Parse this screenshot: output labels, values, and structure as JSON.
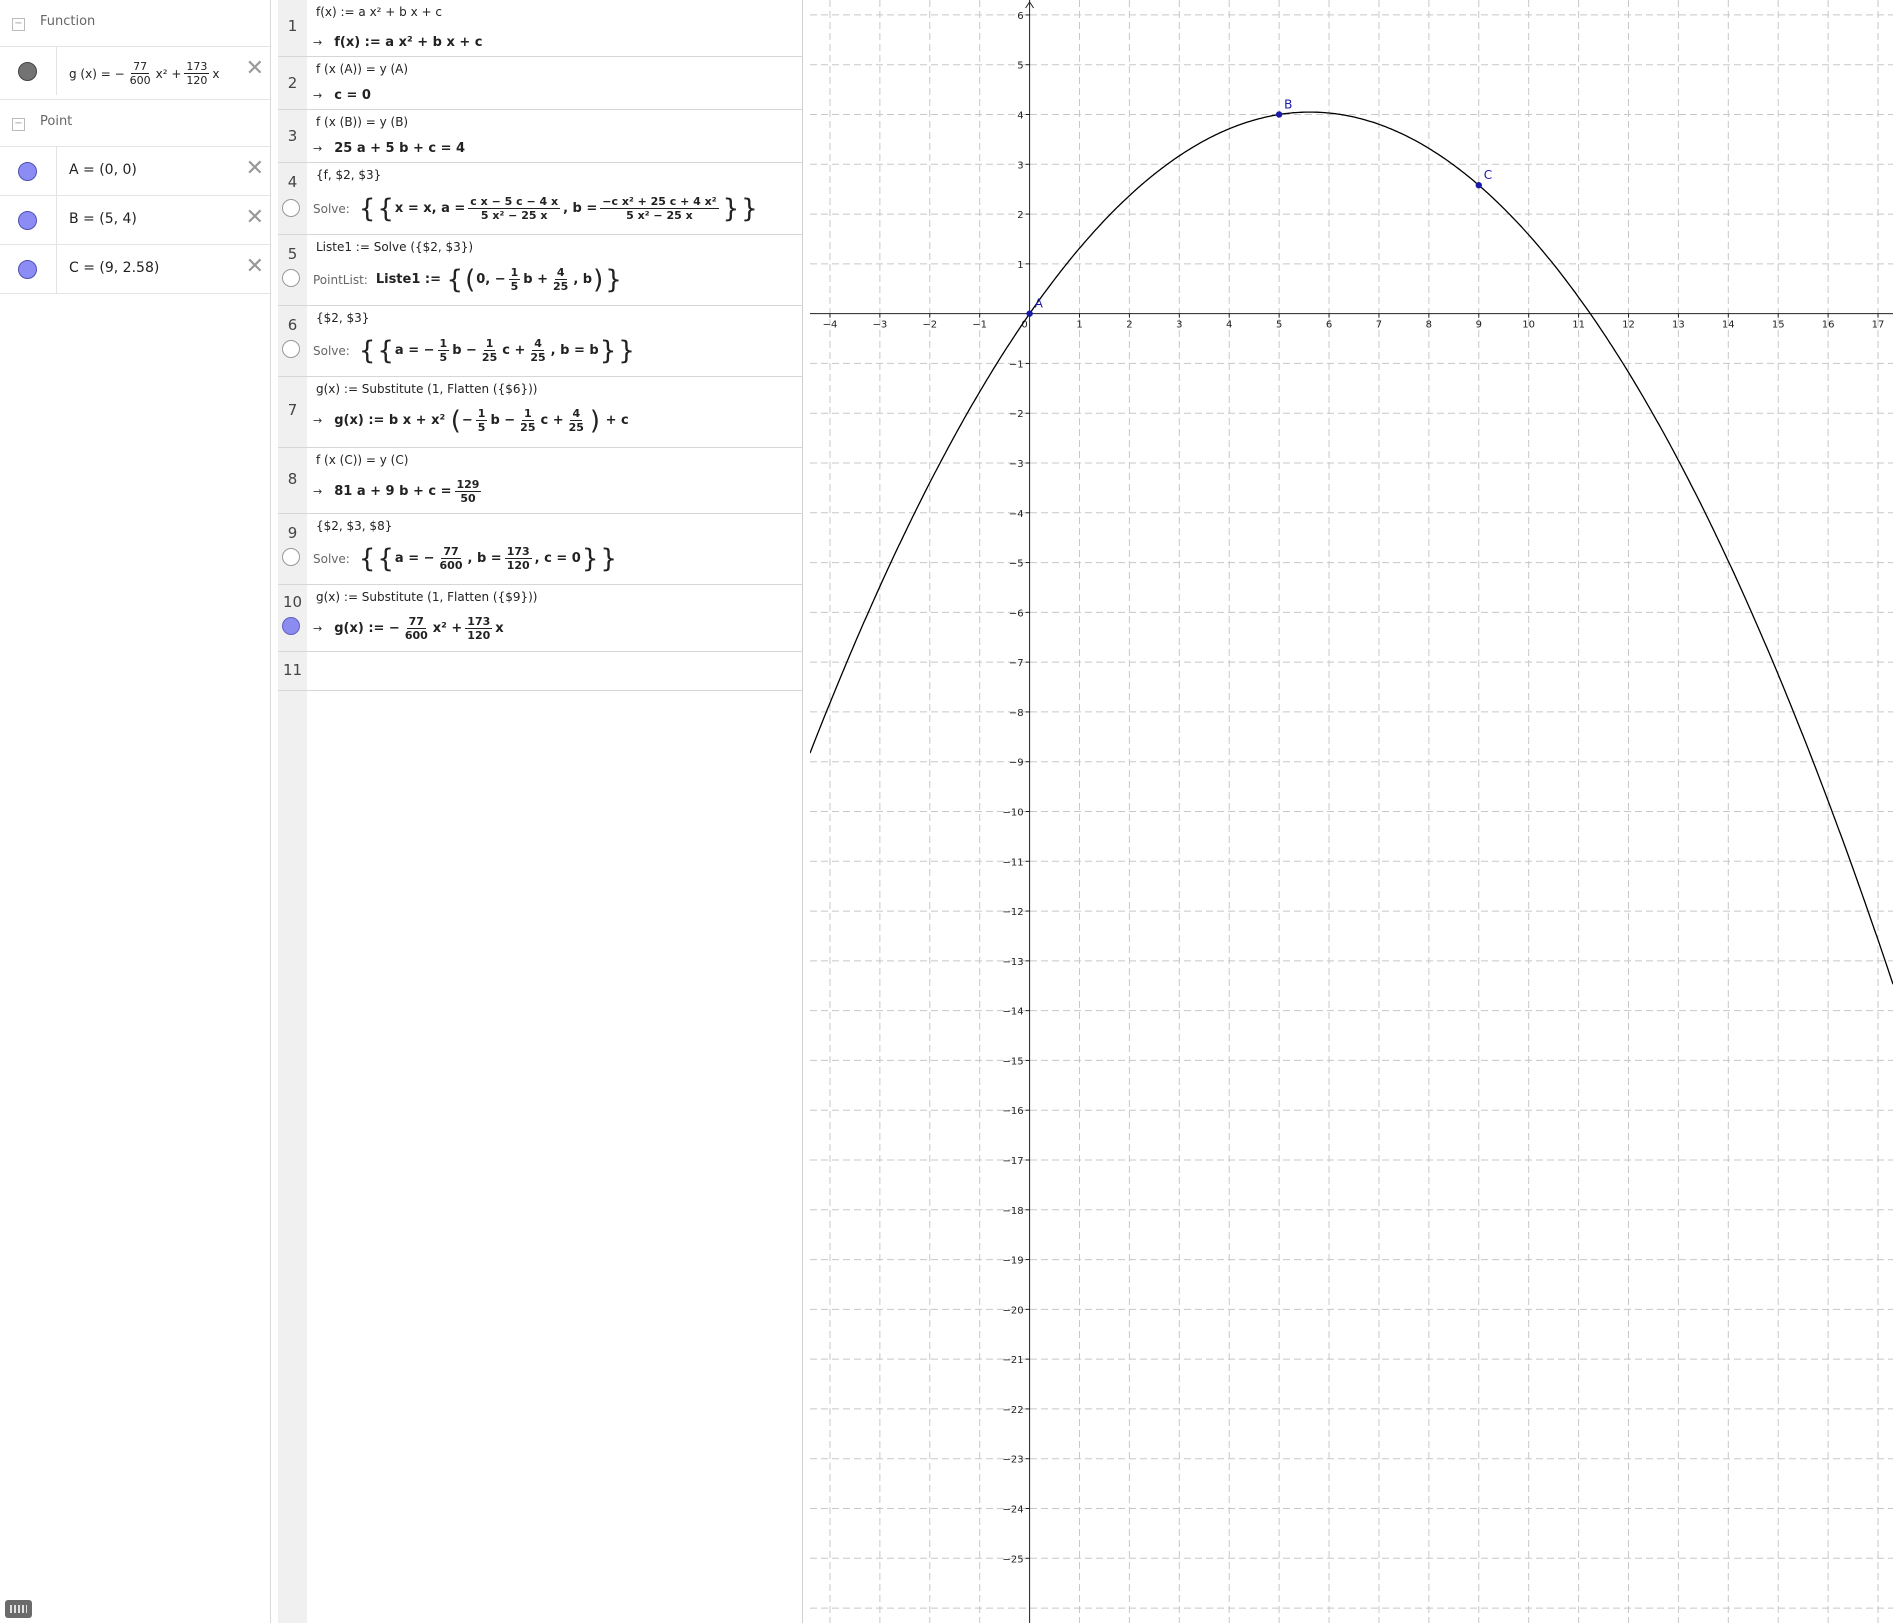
{
  "algebra": {
    "groups": {
      "function": "Function",
      "point": "Point"
    },
    "function": {
      "prefix": "g (x)  =  −",
      "coef_a": {
        "num": "77",
        "den": "600"
      },
      "mid": "x² +",
      "coef_b": {
        "num": "173",
        "den": "120"
      },
      "suffix": "x",
      "color": "#737373"
    },
    "points": [
      {
        "label": "A = (0, 0)",
        "color": "#8c8cf5"
      },
      {
        "label": "B = (5, 4)",
        "color": "#8c8cf5"
      },
      {
        "label": "C = (9, 2.58)",
        "color": "#8c8cf5"
      }
    ],
    "delete_symbol": "✕"
  },
  "cas": {
    "rows": [
      {
        "n": "1",
        "input": "f(x) := a x² + b x + c",
        "output": "f(x)  :=  a x² + b x + c"
      },
      {
        "n": "2",
        "input": "f (x (A)) = y (A)",
        "output": "c = 0"
      },
      {
        "n": "3",
        "input": "f (x (B)) = y (B)",
        "output": "25 a + 5 b + c = 4"
      },
      {
        "n": "4",
        "input": "{f, $2, $3}",
        "label": "Solve:",
        "parts": {
          "p1": "x = x, a =",
          "f1n": "c x − 5 c − 4 x",
          "f1d": "5 x² − 25 x",
          "p2": ", b =",
          "f2n": "−c x² + 25 c + 4 x²",
          "f2d": "5 x² − 25 x"
        }
      },
      {
        "n": "5",
        "input": "Liste1 := Solve ({$2, $3})",
        "label": "PointList:",
        "parts": {
          "p1": "Liste1  :=",
          "p2": "0, −",
          "f1n": "1",
          "f1d": "5",
          "p3": "b +",
          "f2n": "4",
          "f2d": "25",
          "p4": ", b"
        }
      },
      {
        "n": "6",
        "input": "{$2, $3}",
        "label": "Solve:",
        "parts": {
          "p1": "a = −",
          "f1n": "1",
          "f1d": "5",
          "p2": "b −",
          "f2n": "1",
          "f2d": "25",
          "p3": "c +",
          "f3n": "4",
          "f3d": "25",
          "p4": ", b = b"
        }
      },
      {
        "n": "7",
        "input": "g(x) := Substitute (1, Flatten ({$6}))",
        "parts": {
          "p1": "g(x)  :=  b x + x²",
          "p2": "−",
          "f1n": "1",
          "f1d": "5",
          "p3": "b −",
          "f2n": "1",
          "f2d": "25",
          "p4": "c +",
          "f3n": "4",
          "f3d": "25",
          "p5": "+ c"
        }
      },
      {
        "n": "8",
        "input": "f (x (C)) = y (C)",
        "parts": {
          "p1": "81 a + 9 b + c =",
          "f1n": "129",
          "f1d": "50"
        }
      },
      {
        "n": "9",
        "input": "{$2, $3, $8}",
        "label": "Solve:",
        "parts": {
          "p1": "a = −",
          "f1n": "77",
          "f1d": "600",
          "p2": ", b =",
          "f2n": "173",
          "f2d": "120",
          "p3": ", c = 0"
        }
      },
      {
        "n": "10",
        "input": "g(x) := Substitute (1, Flatten ({$9}))",
        "parts": {
          "p1": "g(x)  :=  −",
          "f1n": "77",
          "f1d": "600",
          "p2": "x² +",
          "f2n": "173",
          "f2d": "120",
          "p3": "x"
        }
      },
      {
        "n": "11"
      }
    ],
    "arrow": "→"
  },
  "graph": {
    "x_range": [
      -4.4,
      17.3
    ],
    "y_range": [
      -26.3,
      6.3
    ],
    "x_ticks": [
      "−4",
      "−3",
      "−2",
      "−1",
      "0",
      "1",
      "2",
      "3",
      "4",
      "5",
      "6",
      "7",
      "8",
      "9",
      "10",
      "11",
      "12",
      "13",
      "14",
      "15",
      "16",
      "17"
    ],
    "y_ticks": [
      "6",
      "5",
      "4",
      "3",
      "2",
      "1",
      "−1",
      "−2",
      "−3",
      "−4",
      "−5",
      "−6",
      "−7",
      "−8",
      "−9",
      "−10",
      "−11",
      "−12",
      "−13",
      "−14",
      "−15",
      "−16",
      "−17",
      "−18",
      "−19",
      "−20",
      "−21",
      "−22",
      "−23",
      "−24",
      "−25"
    ],
    "curve": {
      "a": -0.128333,
      "b": 1.441667,
      "c": 0,
      "color": "#000000"
    },
    "points": [
      {
        "name": "A",
        "x": 0,
        "y": 0
      },
      {
        "name": "B",
        "x": 5,
        "y": 4
      },
      {
        "name": "C",
        "x": 9,
        "y": 2.58
      }
    ],
    "point_color": "#1a1aa8",
    "grid": true
  }
}
